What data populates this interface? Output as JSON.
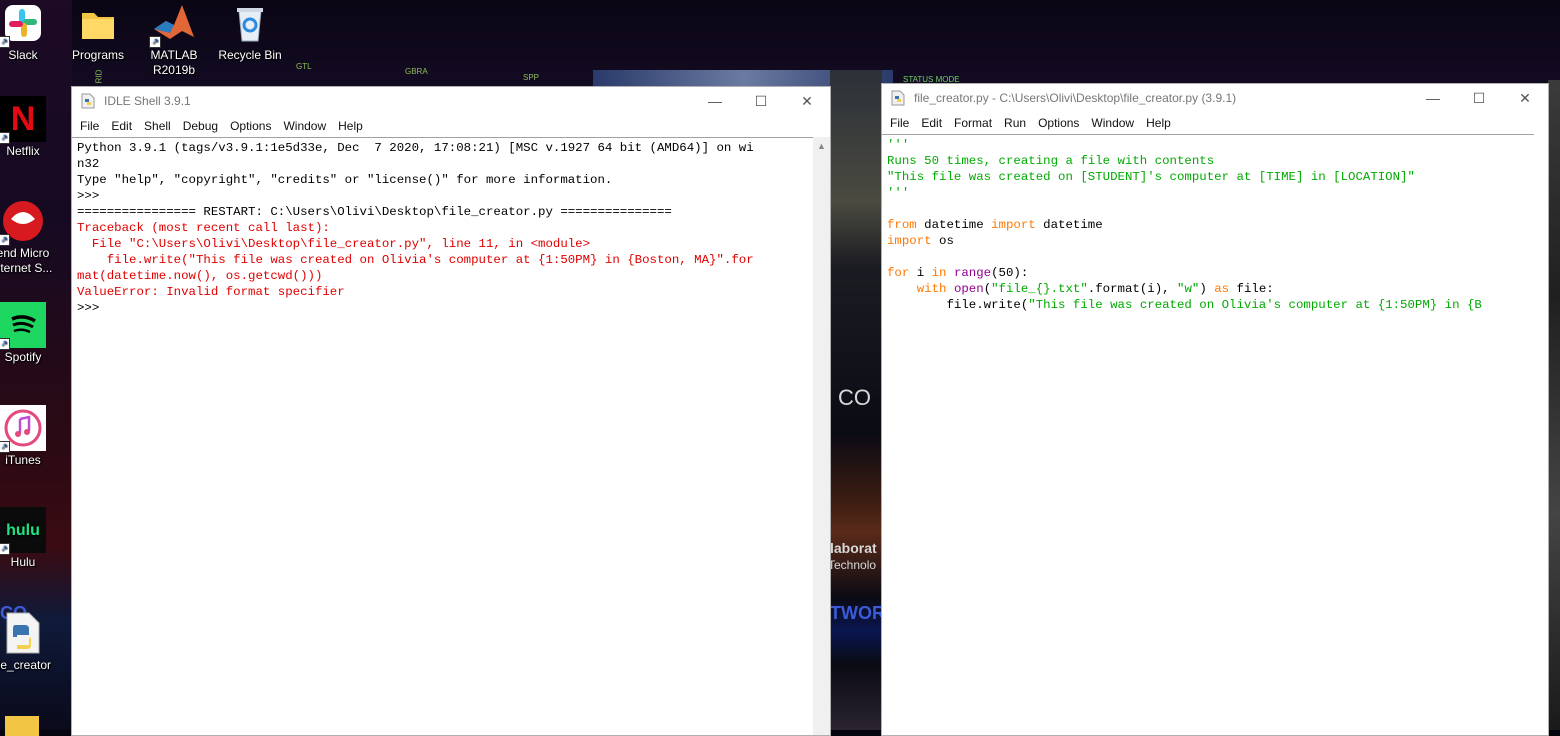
{
  "desktop": {
    "icons": [
      {
        "label": "Slack",
        "icon": "slack-icon"
      },
      {
        "label": "Programs",
        "icon": "folder-icon"
      },
      {
        "label": "MATLAB R2019b",
        "icon": "matlab-icon"
      },
      {
        "label": "Recycle Bin",
        "icon": "recycle-bin-icon"
      },
      {
        "label": "Netflix",
        "icon": "netflix-icon"
      },
      {
        "label": "end Micro\nnternet S...",
        "icon": "trend-micro-icon"
      },
      {
        "label": "Spotify",
        "icon": "spotify-icon"
      },
      {
        "label": "iTunes",
        "icon": "itunes-icon"
      },
      {
        "label": "Hulu",
        "icon": "hulu-icon"
      },
      {
        "label": "ile_creator",
        "icon": "python-file-icon"
      }
    ],
    "wallpaper_labels": [
      "GTL",
      "GBRA",
      "SPP",
      "STATUS MODE",
      "RID"
    ],
    "scene_texts": [
      "CO",
      "laborat",
      "Technolo",
      "TWOR",
      "CO"
    ]
  },
  "shell_window": {
    "title": "IDLE Shell 3.9.1",
    "controls": {
      "minimize": "—",
      "maximize": "☐",
      "close": "✕"
    },
    "menu": [
      "File",
      "Edit",
      "Shell",
      "Debug",
      "Options",
      "Window",
      "Help"
    ],
    "lines": [
      {
        "text": "Python 3.9.1 (tags/v3.9.1:1e5d33e, Dec  7 2020, 17:08:21) [MSC v.1927 64 bit (AMD64)] on wi",
        "color": "#000000"
      },
      {
        "text": "n32",
        "color": "#000000"
      },
      {
        "text": "Type \"help\", \"copyright\", \"credits\" or \"license()\" for more information.",
        "color": "#000000"
      },
      {
        "text": ">>> ",
        "color": "#000000"
      },
      {
        "text": "================ RESTART: C:\\Users\\Olivi\\Desktop\\file_creator.py ===============",
        "color": "#000000"
      },
      {
        "text": "Traceback (most recent call last):",
        "color": "#e00000"
      },
      {
        "text": "  File \"C:\\Users\\Olivi\\Desktop\\file_creator.py\", line 11, in <module>",
        "color": "#e00000"
      },
      {
        "text": "    file.write(\"This file was created on Olivia's computer at {1:50PM} in {Boston, MA}\".for",
        "color": "#e00000"
      },
      {
        "text": "mat(datetime.now(), os.getcwd()))",
        "color": "#e00000"
      },
      {
        "text": "ValueError: Invalid format specifier",
        "color": "#e00000"
      },
      {
        "text": ">>> ",
        "color": "#000000"
      }
    ]
  },
  "editor_window": {
    "title": "file_creator.py - C:\\Users\\Olivi\\Desktop\\file_creator.py (3.9.1)",
    "controls": {
      "minimize": "—",
      "maximize": "☐",
      "close": "✕"
    },
    "menu": [
      "File",
      "Edit",
      "Format",
      "Run",
      "Options",
      "Window",
      "Help"
    ],
    "code": [
      {
        "segments": [
          {
            "t": "'''",
            "c": "str"
          }
        ]
      },
      {
        "segments": [
          {
            "t": "Runs 50 times, creating a file with contents",
            "c": "str"
          }
        ]
      },
      {
        "segments": [
          {
            "t": "\"This file was created on [STUDENT]'s computer at [TIME] in [LOCATION]\"",
            "c": "str"
          }
        ]
      },
      {
        "segments": [
          {
            "t": "'''",
            "c": "str"
          }
        ]
      },
      {
        "segments": [
          {
            "t": "",
            "c": "blk"
          }
        ]
      },
      {
        "segments": [
          {
            "t": "from",
            "c": "kw"
          },
          {
            "t": " datetime ",
            "c": "blk"
          },
          {
            "t": "import",
            "c": "kw"
          },
          {
            "t": " datetime",
            "c": "blk"
          }
        ]
      },
      {
        "segments": [
          {
            "t": "import",
            "c": "kw"
          },
          {
            "t": " os",
            "c": "blk"
          }
        ]
      },
      {
        "segments": [
          {
            "t": "",
            "c": "blk"
          }
        ]
      },
      {
        "segments": [
          {
            "t": "for",
            "c": "kw"
          },
          {
            "t": " i ",
            "c": "blk"
          },
          {
            "t": "in",
            "c": "kw"
          },
          {
            "t": " ",
            "c": "blk"
          },
          {
            "t": "range",
            "c": "bi"
          },
          {
            "t": "(50):",
            "c": "blk"
          }
        ]
      },
      {
        "segments": [
          {
            "t": "    ",
            "c": "blk"
          },
          {
            "t": "with",
            "c": "kw"
          },
          {
            "t": " ",
            "c": "blk"
          },
          {
            "t": "open",
            "c": "bi"
          },
          {
            "t": "(",
            "c": "blk"
          },
          {
            "t": "\"file_{}.txt\"",
            "c": "str"
          },
          {
            "t": ".format(i), ",
            "c": "blk"
          },
          {
            "t": "\"w\"",
            "c": "str"
          },
          {
            "t": ") ",
            "c": "blk"
          },
          {
            "t": "as",
            "c": "kw"
          },
          {
            "t": " file:",
            "c": "blk"
          }
        ]
      },
      {
        "segments": [
          {
            "t": "        file.write(",
            "c": "blk"
          },
          {
            "t": "\"This file was created on Olivia's computer at {1:50PM} in {B",
            "c": "str"
          }
        ]
      }
    ]
  },
  "colors": {
    "keyword": "#ff7700",
    "string": "#00aa00",
    "builtin": "#900090",
    "error": "#e00000"
  }
}
